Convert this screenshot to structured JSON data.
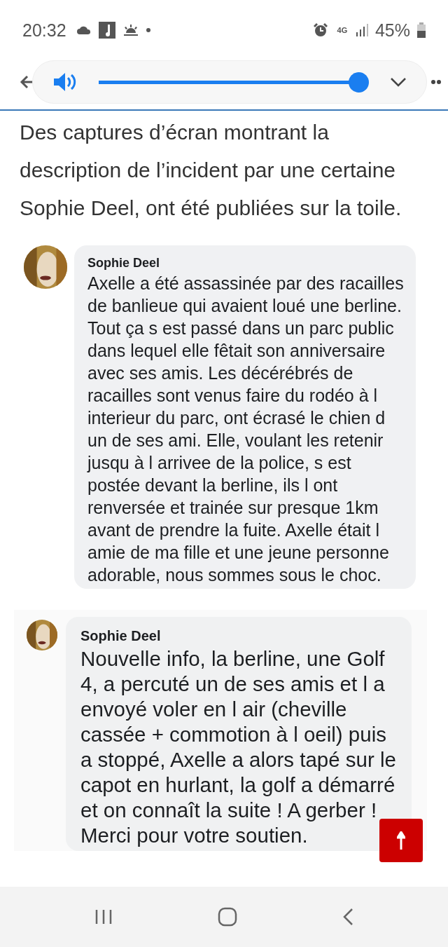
{
  "status_bar": {
    "time": "20:32",
    "network": "4G",
    "battery": "45%"
  },
  "media_bar": {
    "level": 1
  },
  "article": {
    "paragraph": "Des captures d’écran montrant la description de l’incident par une certaine Sophie Deel, ont été publiées sur la toile."
  },
  "comments": [
    {
      "kind": "plain",
      "author": "Sophie Deel",
      "text": "Axelle a été assassinée par des racailles de banlieue qui avaient loué une berline. Tout ça s est passé dans un parc public dans lequel elle fêtait son anniversaire avec ses amis. Les décérébrés de racailles sont venus faire du rodéo  à l interieur du parc, ont écrasé le chien d un de ses ami. Elle, voulant les retenir jusqu à l arrivee de la police, s est postée devant la berline, ils l ont renversée et trainée sur presque 1km avant de prendre la fuite. Axelle était l amie de ma fille et une jeune personne adorable, nous sommes sous le choc."
    },
    {
      "kind": "framed",
      "author": "Sophie Deel",
      "text": "Nouvelle info, la berline, une Golf 4, a percuté un de ses amis et l a envoyé voler en l air (cheville cassée + commotion à l oeil) puis a stoppé, Axelle a alors tapé sur le capot en hurlant, la golf a démarré et on connaît la suite ! A gerber ! Merci pour votre soutien."
    }
  ]
}
